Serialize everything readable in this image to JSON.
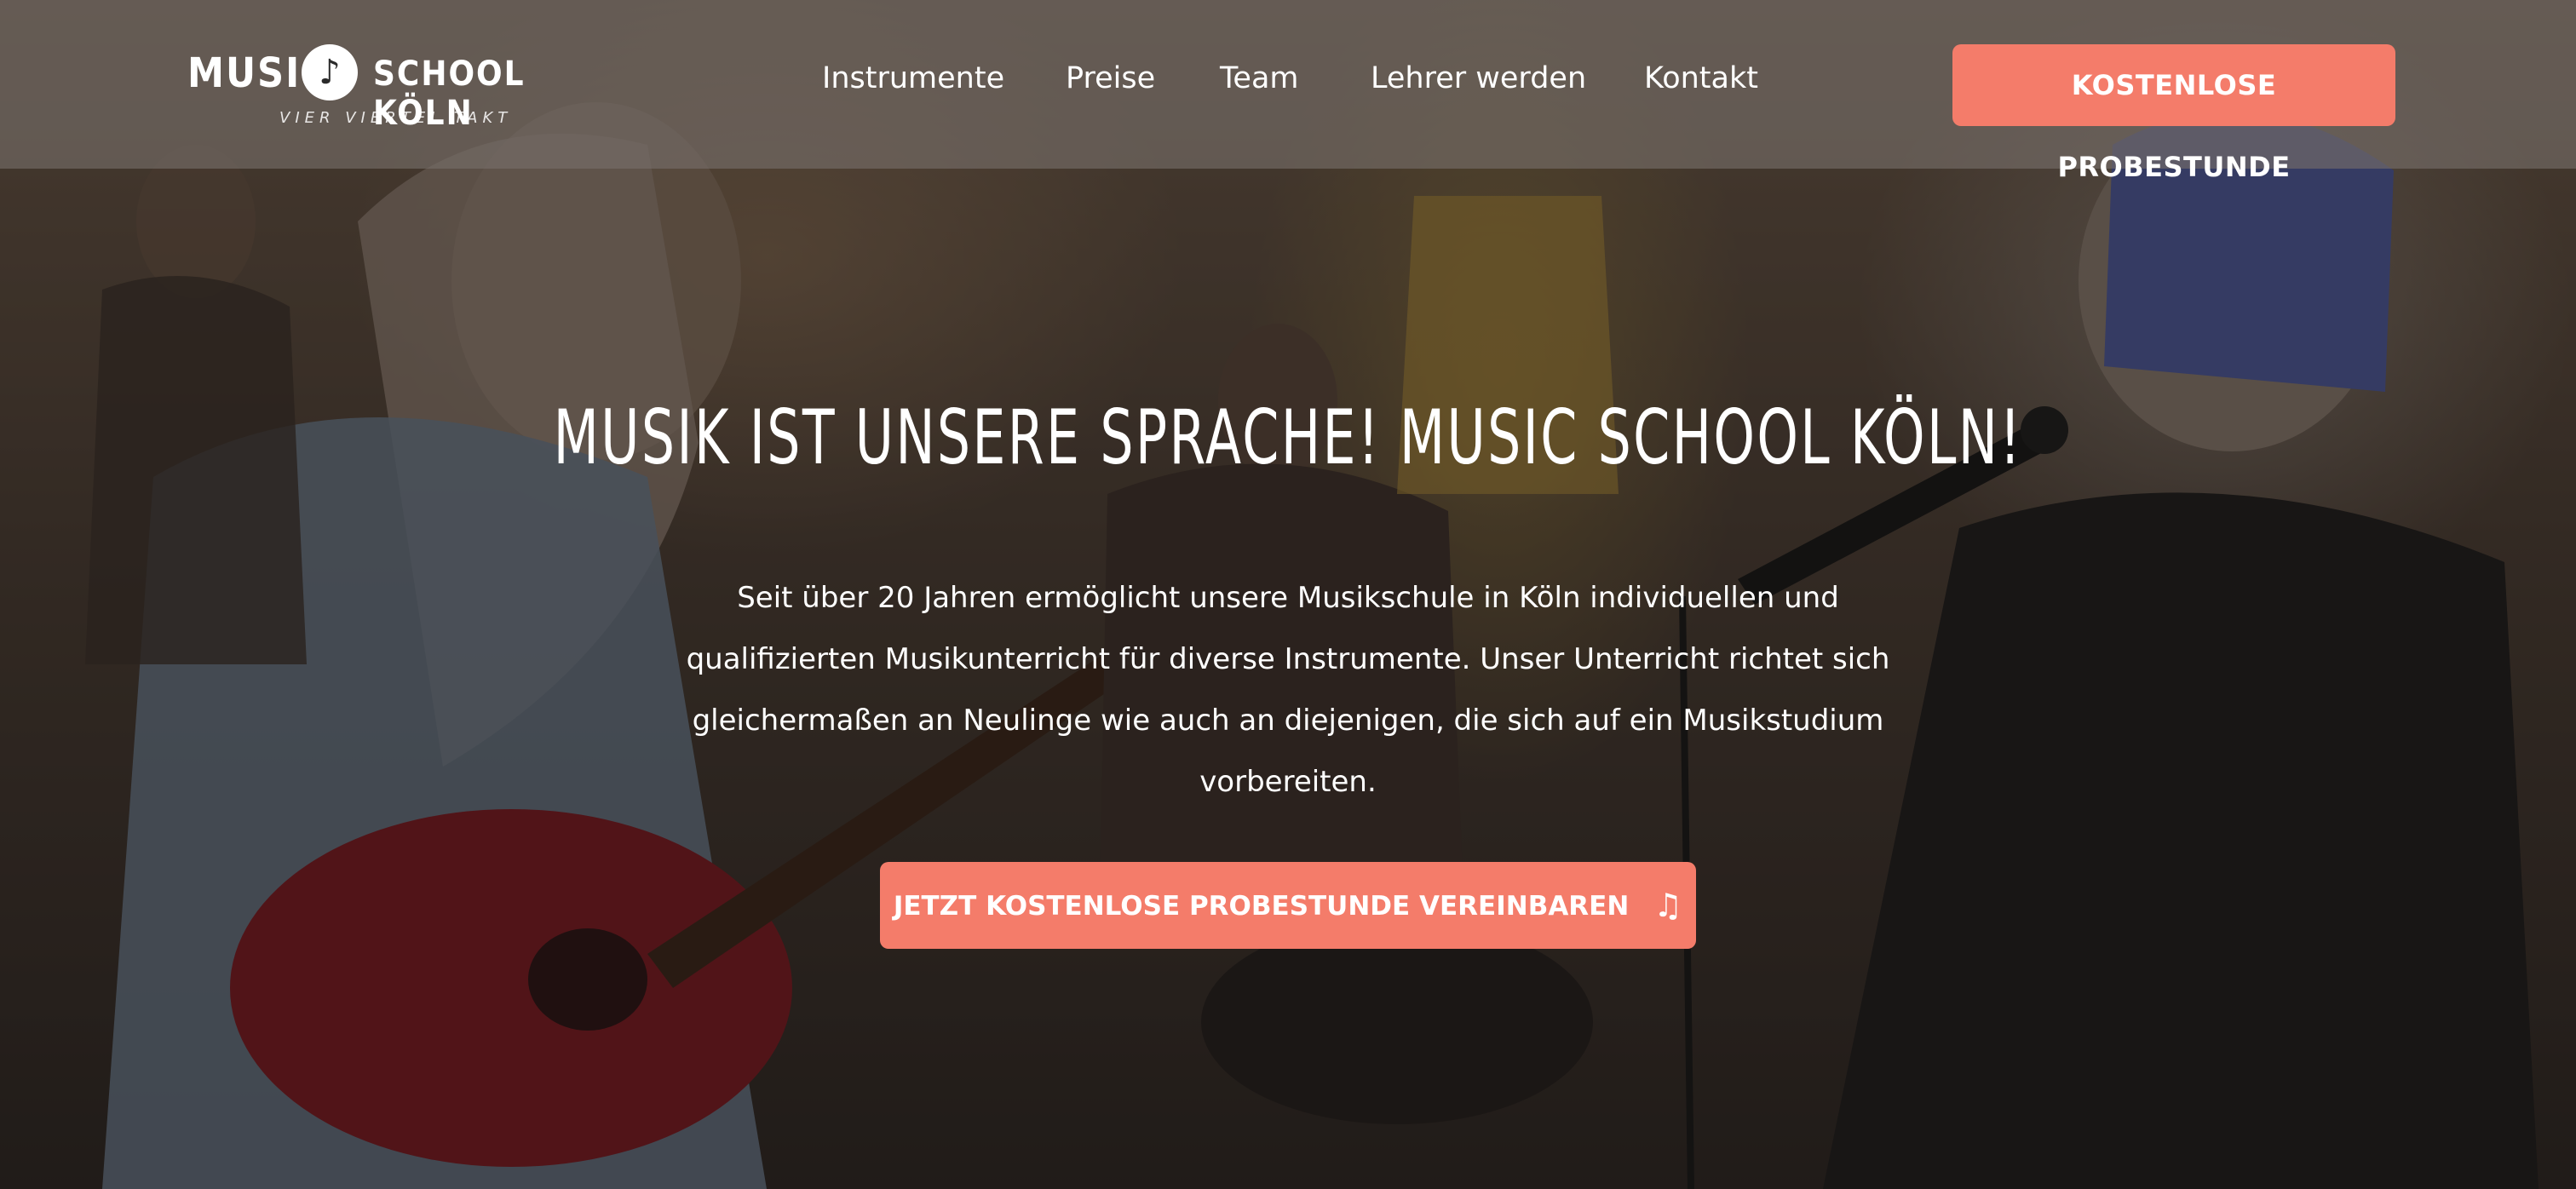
{
  "header": {
    "logo": {
      "left": "MUSIC",
      "badge_icon": "music-note-icon",
      "badge_glyph": "♪",
      "right": "SCHOOL KÖLN",
      "tagline": "VIER VIERTEL TAKT"
    },
    "nav": [
      {
        "label": "Instrumente"
      },
      {
        "label": "Preise"
      },
      {
        "label": "Team"
      },
      {
        "label": "Lehrer werden"
      },
      {
        "label": "Kontakt"
      }
    ],
    "cta_label": "KOSTENLOSE PROBESTUNDE"
  },
  "hero": {
    "title": "Musik ist unsere Sprache! Music School Köln!",
    "description": "Seit über 20 Jahren ermöglicht unsere Musikschule in Köln individuellen und qualifizierten Musikunterricht für diverse Instrumente. Unser Unterricht richtet sich gleichermaßen an Neulinge wie auch an diejenigen, die sich auf ein Musikstudium vorbereiten.",
    "cta_label": "JETZT KOSTENLOSE PROBESTUNDE VEREINBAREN",
    "cta_icon": "music-note-icon",
    "cta_glyph": "♫"
  },
  "colors": {
    "accent": "#f47c6a",
    "header_bg": "#78706a",
    "text": "#ffffff"
  }
}
